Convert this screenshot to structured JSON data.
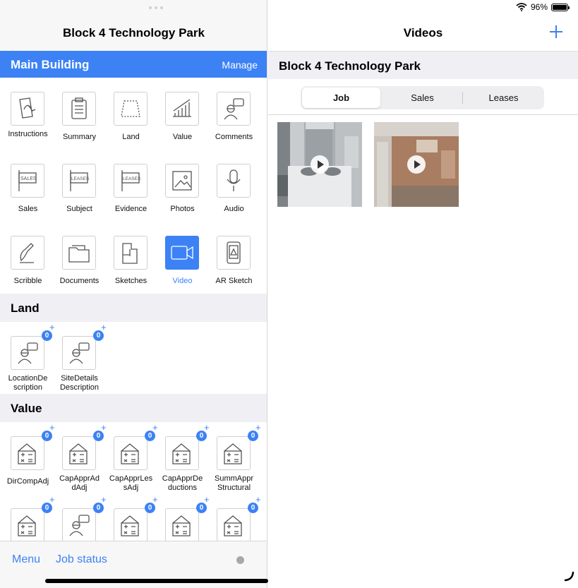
{
  "left": {
    "title": "Block 4 Technology Park",
    "building": {
      "name": "Main Building",
      "manage_label": "Manage"
    },
    "tools": [
      {
        "label": "Instructions",
        "icon": "instructions-icon"
      },
      {
        "label": "Summary",
        "icon": "clipboard-icon"
      },
      {
        "label": "Land",
        "icon": "land-plot-icon"
      },
      {
        "label": "Value",
        "icon": "value-chart-icon"
      },
      {
        "label": "Comments",
        "icon": "comment-person-icon"
      },
      {
        "label": "Sales",
        "icon": "sales-sign-icon"
      },
      {
        "label": "Subject",
        "icon": "leases-sign-icon"
      },
      {
        "label": "Evidence",
        "icon": "leases-sign-icon"
      },
      {
        "label": "Photos",
        "icon": "photos-icon"
      },
      {
        "label": "Audio",
        "icon": "microphone-icon"
      },
      {
        "label": "Scribble",
        "icon": "pen-icon"
      },
      {
        "label": "Documents",
        "icon": "folder-icon"
      },
      {
        "label": "Sketches",
        "icon": "floorplan-icon"
      },
      {
        "label": "Video",
        "icon": "video-camera-icon",
        "active": true
      },
      {
        "label": "AR Sketch",
        "icon": "ar-phone-icon"
      }
    ],
    "sections": {
      "land": {
        "title": "Land",
        "items": [
          {
            "label": "LocationDe scription",
            "count": "0"
          },
          {
            "label": "SiteDetails Description",
            "count": "0"
          }
        ]
      },
      "value": {
        "title": "Value",
        "items": [
          {
            "label": "DirCompAdj",
            "count": "0"
          },
          {
            "label": "CapApprAd dAdj",
            "count": "0"
          },
          {
            "label": "CapApprLes sAdj",
            "count": "0"
          },
          {
            "label": "CapApprDe ductions",
            "count": "0"
          },
          {
            "label": "SummAppr Structural",
            "count": "0"
          },
          {
            "label": "",
            "count": "0"
          },
          {
            "label": "",
            "count": "0"
          },
          {
            "label": "",
            "count": "0"
          },
          {
            "label": "",
            "count": "0"
          },
          {
            "label": "",
            "count": "0"
          }
        ]
      }
    },
    "bottom": {
      "menu_label": "Menu",
      "job_status_label": "Job status"
    }
  },
  "right": {
    "status": {
      "battery": "96%"
    },
    "title": "Videos",
    "add_icon": "plus-icon",
    "property_title": "Block 4 Technology Park",
    "segments": [
      "Job",
      "Sales",
      "Leases"
    ],
    "selected_segment": "Job",
    "videos": [
      {
        "name": "bathroom-video"
      },
      {
        "name": "exterior-brick-video"
      }
    ]
  },
  "colors": {
    "accent": "#3c82f5",
    "section_bg": "#efeff4"
  }
}
